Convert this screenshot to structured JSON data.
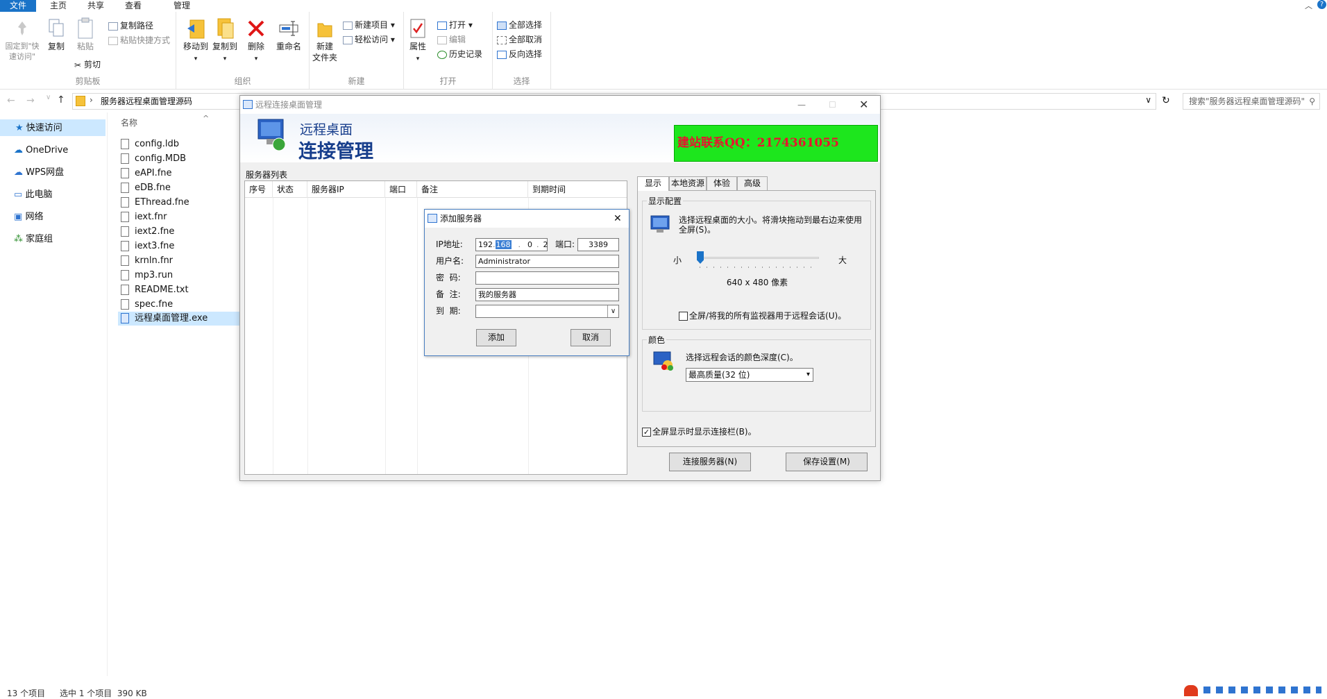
{
  "ribbon_tabs": {
    "file": "文件",
    "home": "主页",
    "share": "共享",
    "view": "查看",
    "manage": "管理"
  },
  "ribbon": {
    "clipboard": {
      "pin": "固定到\"快速访问\"",
      "copy": "复制",
      "paste": "粘贴",
      "copy_path": "复制路径",
      "paste_shortcut": "粘贴快捷方式",
      "cut": "剪切",
      "label": "剪贴板"
    },
    "organize": {
      "move_to": "移动到",
      "copy_to": "复制到",
      "delete": "删除",
      "rename": "重命名",
      "label": "组织"
    },
    "new": {
      "new_folder": "新建\n文件夹",
      "new_item": "新建项目 ▾",
      "easy_access": "轻松访问 ▾",
      "label": "新建"
    },
    "open": {
      "properties": "属性",
      "open": "打开 ▾",
      "edit": "编辑",
      "history": "历史记录",
      "label": "打开"
    },
    "select": {
      "select_all": "全部选择",
      "select_none": "全部取消",
      "invert": "反向选择",
      "label": "选择"
    }
  },
  "address": {
    "path": "服务器远程桌面管理源码",
    "search_placeholder": "搜索\"服务器远程桌面管理源码\""
  },
  "nav": {
    "quick_access": "快速访问",
    "onedrive": "OneDrive",
    "wps": "WPS网盘",
    "this_pc": "此电脑",
    "network": "网络",
    "homegroup": "家庭组"
  },
  "files": {
    "column": "名称",
    "items": [
      "config.ldb",
      "config.MDB",
      "eAPI.fne",
      "eDB.fne",
      "EThread.fne",
      "iext.fnr",
      "iext2.fne",
      "iext3.fne",
      "krnln.fnr",
      "mp3.run",
      "README.txt",
      "spec.fne",
      "远程桌面管理.exe"
    ]
  },
  "status": {
    "count": "13 个项目",
    "selected": "选中 1 个项目  390 KB"
  },
  "app": {
    "title": "远程连接桌面管理",
    "banner_line1": "远程桌面",
    "banner_line2": "连接管理",
    "qq": "建站联系QQ：2174361055",
    "server_list_label": "服务器列表",
    "columns": [
      "序号",
      "状态",
      "服务器IP",
      "端口",
      "备注",
      "到期时间"
    ],
    "tabs": [
      "显示",
      "本地资源",
      "体验",
      "高级"
    ],
    "display_group": "显示配置",
    "display_desc": "选择远程桌面的大小。将滑块拖动到最右边来使用全屏(S)。",
    "slider_small": "小",
    "slider_large": "大",
    "slider_level": 0,
    "resolution": "640 x 480 像素",
    "fullscreen_all": "全屏/将我的所有监视器用于远程会话(U)。",
    "color_group": "颜色",
    "color_desc": "选择远程会话的颜色深度(C)。",
    "color_value": "最高质量(32 位)",
    "show_bar": "全屏显示时显示连接栏(B)。",
    "connect": "连接服务器(N)",
    "save": "保存设置(M)"
  },
  "dialog": {
    "title": "添加服务器",
    "ip_label": "IP地址:",
    "ip": [
      "192",
      "168",
      "0",
      "2"
    ],
    "port_label": "端口:",
    "port": "3389",
    "user_label": "用户名:",
    "user": "Administrator",
    "pwd_label": "密  码:",
    "pwd": "",
    "note_label": "备  注:",
    "note": "我的服务器",
    "expire_label": "到  期:",
    "expire": "",
    "add": "添加",
    "cancel": "取消"
  },
  "colors": {
    "accent": "#1a73c8",
    "qq_bg": "#1de61d",
    "qq_text": "#e8132f",
    "banner_text": "#173e8c"
  }
}
